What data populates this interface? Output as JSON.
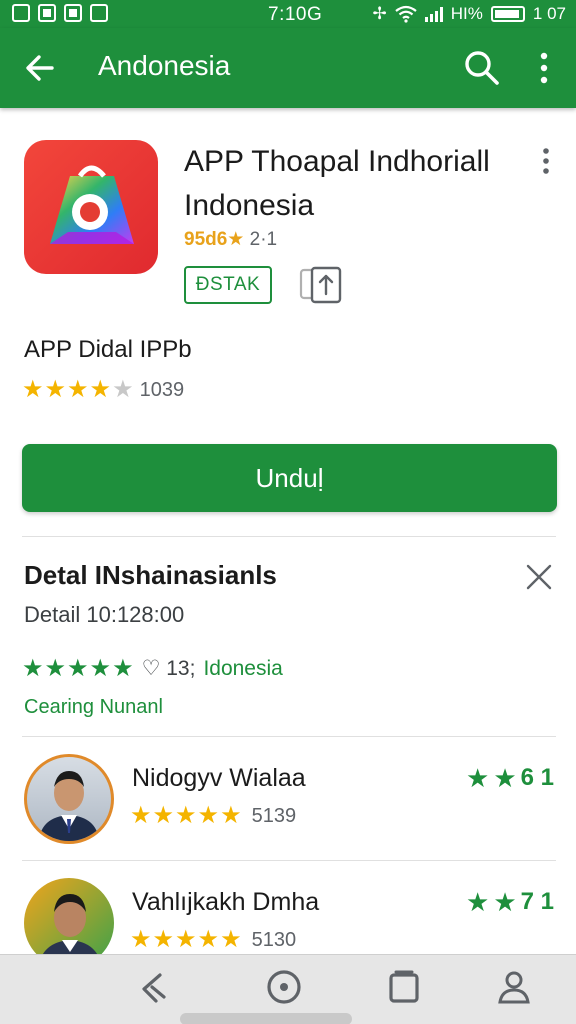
{
  "status_bar": {
    "time": "7:10G",
    "right_text": "HI%",
    "battery_text": "1 07"
  },
  "app_bar": {
    "title": "Andonesia",
    "icons": [
      "back-arrow-icon",
      "search-icon",
      "more-vert-icon"
    ]
  },
  "app": {
    "name": "APP Thoapal Indhoriall Indonesia",
    "developer": "95d6★",
    "version": "2·1",
    "badge": "ĐSTAK",
    "subtitle": "APP Didal IPPb",
    "rating_stars": 4,
    "rating_count": "1039",
    "download_label": "Unduḷ",
    "accent": "#1e8f3c"
  },
  "detail": {
    "title": "Detal INshainasianls",
    "line": "Detail 10:128:00",
    "stars": 5,
    "rating_text": "♡ 13;",
    "location": "Idonesia",
    "link": "Cearing Nunanl"
  },
  "reviews": [
    {
      "name": "Nidogyv Wialaa",
      "stars": 5,
      "count": "5139",
      "score_stars": 2,
      "score": "6 1"
    },
    {
      "name": "Vahlıjkakh Dmha",
      "stars": 5,
      "count": "5130",
      "score_stars": 2,
      "score": "7 1"
    }
  ],
  "bottom_nav": {
    "items": [
      "back-nav-icon",
      "home-nav-icon",
      "recents-nav-icon",
      "profile-nav-icon"
    ]
  }
}
